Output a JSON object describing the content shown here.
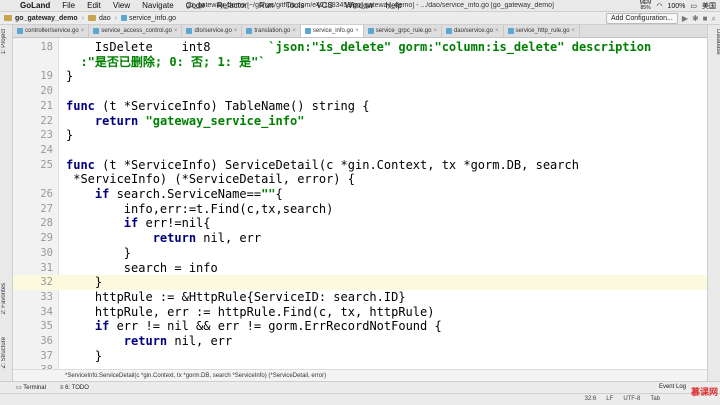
{
  "menubar": {
    "app": "GoLand",
    "items": [
      "File",
      "Edit",
      "View",
      "Navigate",
      "Code",
      "Refactor",
      "Run",
      "Tools",
      "VCS",
      "Window",
      "Help"
    ],
    "window_title": "go_gateway_demo [~/go/src/github.com/e421083458/go_gateway_demo] - .../dao/service_info.go [go_gateway_demo]",
    "mem_label": "MEM",
    "mem_value": "85%",
    "battery": "100%",
    "input_method": "美国"
  },
  "navbar": {
    "project": "go_gateway_demo",
    "folder": "dao",
    "file": "service_info.go",
    "run_config": "Add Configuration..."
  },
  "left_tools": {
    "project": "1: Project",
    "favorites": "2: Favorites",
    "structure": "Z: Structure"
  },
  "right_tools": {
    "database": "Database"
  },
  "tabs": [
    {
      "label": "controller/service.go",
      "active": false
    },
    {
      "label": "service_access_control.go",
      "active": false
    },
    {
      "label": "dto/service.go",
      "active": false
    },
    {
      "label": "translation.go",
      "active": false
    },
    {
      "label": "service_info.go",
      "active": true
    },
    {
      "label": "service_grpc_rule.go",
      "active": false
    },
    {
      "label": "dao/service.go",
      "active": false
    },
    {
      "label": "service_http_rule.go",
      "active": false
    }
  ],
  "code_lines": [
    {
      "n": "18",
      "html": "    IsDelete    int8        <span class='str'>`json:\"is_delete\" gorm:\"column:is_delete\" description</span>"
    },
    {
      "n": "",
      "html": "  <span class='str'>:\"是否已删除; 0: 否; 1: 是\"`</span>"
    },
    {
      "n": "19",
      "html": "}"
    },
    {
      "n": "20",
      "html": ""
    },
    {
      "n": "21",
      "html": "<span class='kw'>func</span> (t *ServiceInfo) TableName() string {"
    },
    {
      "n": "22",
      "html": "    <span class='kw'>return</span> <span class='str'>\"gateway_service_info\"</span>"
    },
    {
      "n": "23",
      "html": "}"
    },
    {
      "n": "24",
      "html": ""
    },
    {
      "n": "25",
      "html": "<span class='kw'>func</span> (t *ServiceInfo) ServiceDetail(c *gin.Context, tx *gorm.DB, search"
    },
    {
      "n": "",
      "html": " *ServiceInfo) (*ServiceDetail, error) {"
    },
    {
      "n": "26",
      "html": "    <span class='kw'>if</span> search.ServiceName==<span class='str'>\"\"</span>{"
    },
    {
      "n": "27",
      "html": "        info,err:=t.Find(c,tx,search)"
    },
    {
      "n": "28",
      "html": "        <span class='kw'>if</span> err!=nil{"
    },
    {
      "n": "29",
      "html": "            <span class='kw'>return</span> nil, err"
    },
    {
      "n": "30",
      "html": "        }"
    },
    {
      "n": "31",
      "html": "        search = info"
    },
    {
      "n": "32",
      "html": "    }",
      "current": true
    },
    {
      "n": "33",
      "html": "    httpRule := &amp;HttpRule{ServiceID: search.ID}"
    },
    {
      "n": "34",
      "html": "    httpRule, err := httpRule.Find(c, tx, httpRule)"
    },
    {
      "n": "35",
      "html": "    <span class='kw'>if</span> err != nil &amp;&amp; err != gorm.ErrRecordNotFound {"
    },
    {
      "n": "36",
      "html": "        <span class='kw'>return</span> nil, err"
    },
    {
      "n": "37",
      "html": "    }"
    },
    {
      "n": "38",
      "html": "    ..."
    }
  ],
  "hint": "*ServiceInfo.ServiceDetail(c *gin.Context, tx *gorm.DB, search *ServiceInfo) (*ServiceDetail, error)",
  "bottom_tools": {
    "terminal": "Terminal",
    "todo": "6: TODO",
    "event_log": "Event Log"
  },
  "status": {
    "position": "32:6",
    "line_sep": "LF",
    "encoding": "UTF-8",
    "tab": "Tab"
  },
  "watermark": "慕课网"
}
